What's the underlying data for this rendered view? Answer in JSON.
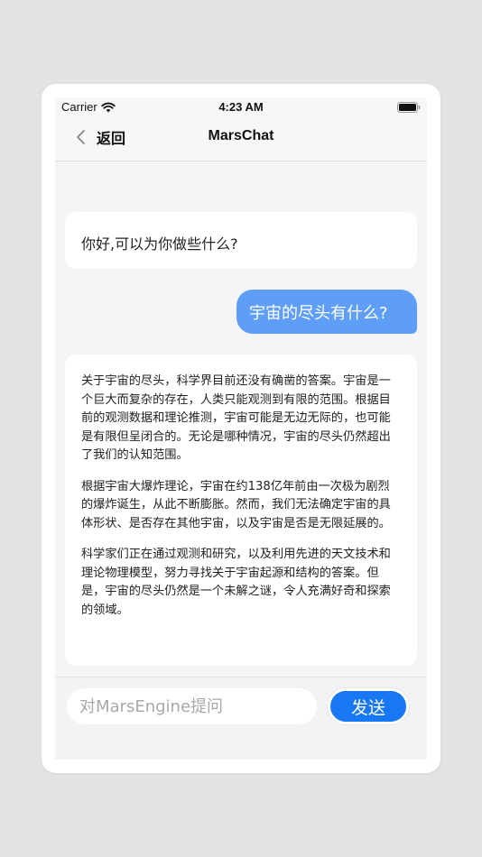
{
  "status_bar": {
    "carrier": "Carrier",
    "time": "4:23 AM"
  },
  "nav": {
    "back_label": "返回",
    "title": "MarsChat"
  },
  "messages": [
    {
      "role": "bot",
      "text": "你好,可以为你做些什么?"
    },
    {
      "role": "user",
      "text": "宇宙的尽头有什么?"
    },
    {
      "role": "bot",
      "paragraphs": [
        "关于宇宙的尽头，科学界目前还没有确凿的答案。宇宙是一个巨大而复杂的存在，人类只能观测到有限的范围。根据目前的观测数据和理论推测，宇宙可能是无边无际的，也可能是有限但呈闭合的。无论是哪种情况，宇宙的尽头仍然超出了我们的认知范围。",
        "根据宇宙大爆炸理论，宇宙在约138亿年前由一次极为剧烈的爆炸诞生，从此不断膨胀。然而，我们无法确定宇宙的具体形状、是否存在其他宇宙，以及宇宙是否是无限延展的。",
        "科学家们正在通过观测和研究，以及利用先进的天文技术和理论物理模型，努力寻找关于宇宙起源和结构的答案。但是，宇宙的尽头仍然是一个未解之谜，令人充满好奇和探索的领域。"
      ]
    }
  ],
  "input": {
    "placeholder": "对MarsEngine提问",
    "value": "",
    "send_label": "发送"
  },
  "colors": {
    "user_bubble": "#5f9ef7",
    "send_button": "#1877f2",
    "background": "#f5f5f7"
  }
}
